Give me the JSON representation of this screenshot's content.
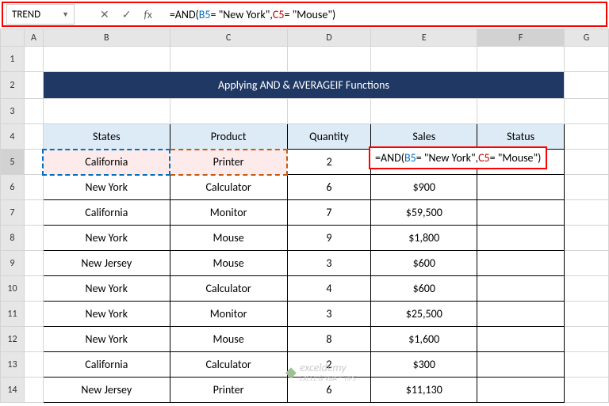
{
  "nameBox": "TREND",
  "formula": {
    "prefix": "=AND(",
    "ref1": "B5",
    "mid1": "= \"New York\",",
    "ref2": "C5",
    "suffix": "= \"Mouse\")"
  },
  "cols": [
    "A",
    "B",
    "C",
    "D",
    "E",
    "F",
    "G"
  ],
  "title": "Applying AND & AVERAGEIF Functions",
  "headers": {
    "b": "States",
    "c": "Product",
    "d": "Quantity",
    "e": "Sales",
    "f": "Status"
  },
  "rows": [
    {
      "n": "5",
      "b": "California",
      "c": "Printer",
      "d": "2",
      "e": "",
      "f": ""
    },
    {
      "n": "6",
      "b": "New York",
      "c": "Calculator",
      "d": "6",
      "e": "$900",
      "f": ""
    },
    {
      "n": "7",
      "b": "California",
      "c": "Monitor",
      "d": "7",
      "e": "$59,500",
      "f": ""
    },
    {
      "n": "8",
      "b": "New York",
      "c": "Mouse",
      "d": "9",
      "e": "$1,800",
      "f": ""
    },
    {
      "n": "9",
      "b": "New Jersey",
      "c": "Mouse",
      "d": "3",
      "e": "$600",
      "f": ""
    },
    {
      "n": "10",
      "b": "New York",
      "c": "Calculator",
      "d": "4",
      "e": "$600",
      "f": ""
    },
    {
      "n": "11",
      "b": "New York",
      "c": "Monitor",
      "d": "3",
      "e": "$25,500",
      "f": ""
    },
    {
      "n": "12",
      "b": "New York",
      "c": "Mouse",
      "d": "8",
      "e": "$1,600",
      "f": ""
    },
    {
      "n": "13",
      "b": "California",
      "c": "Calculator",
      "d": "2",
      "e": "$300",
      "f": ""
    },
    {
      "n": "14",
      "b": "New Jersey",
      "c": "Printer",
      "d": "6",
      "e": "$11,130",
      "f": ""
    }
  ],
  "watermark": {
    "brand": "exceldemy",
    "tag": "EXCEL & VBA * TIPS"
  },
  "chart_data": {
    "type": "table",
    "title": "Applying AND & AVERAGEIF Functions",
    "columns": [
      "States",
      "Product",
      "Quantity",
      "Sales",
      "Status"
    ],
    "rows": [
      [
        "California",
        "Printer",
        2,
        null,
        null
      ],
      [
        "New York",
        "Calculator",
        6,
        900,
        null
      ],
      [
        "California",
        "Monitor",
        7,
        59500,
        null
      ],
      [
        "New York",
        "Mouse",
        9,
        1800,
        null
      ],
      [
        "New Jersey",
        "Mouse",
        3,
        600,
        null
      ],
      [
        "New York",
        "Calculator",
        4,
        600,
        null
      ],
      [
        "New York",
        "Monitor",
        3,
        25500,
        null
      ],
      [
        "New York",
        "Mouse",
        8,
        1600,
        null
      ],
      [
        "California",
        "Calculator",
        2,
        300,
        null
      ],
      [
        "New Jersey",
        "Printer",
        6,
        11130,
        null
      ]
    ]
  }
}
